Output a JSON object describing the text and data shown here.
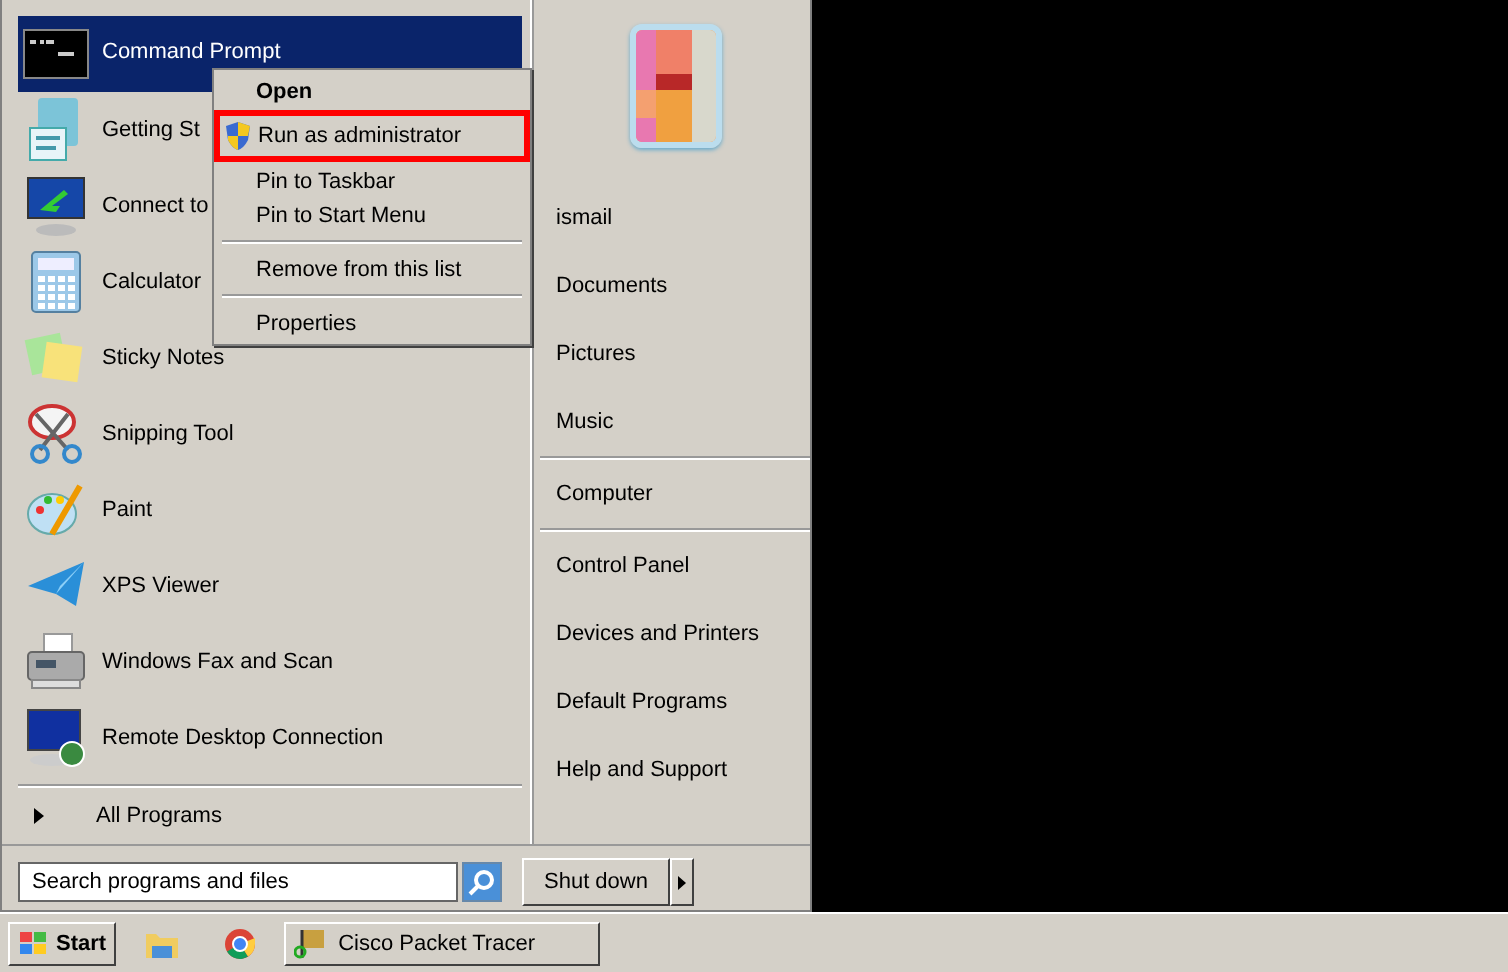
{
  "programs": [
    {
      "label": "Command Prompt",
      "selected": true
    },
    {
      "label": "Getting St",
      "selected": false
    },
    {
      "label": "Connect to",
      "selected": false
    },
    {
      "label": "Calculator",
      "selected": false
    },
    {
      "label": "Sticky Notes",
      "selected": false
    },
    {
      "label": "Snipping Tool",
      "selected": false
    },
    {
      "label": "Paint",
      "selected": false
    },
    {
      "label": "XPS Viewer",
      "selected": false
    },
    {
      "label": "Windows Fax and Scan",
      "selected": false
    },
    {
      "label": "Remote Desktop Connection",
      "selected": false
    }
  ],
  "all_programs": "All Programs",
  "search": {
    "placeholder": "Search programs and files"
  },
  "places": [
    {
      "label": "ismail",
      "kind": "item"
    },
    {
      "label": "Documents",
      "kind": "item"
    },
    {
      "label": "Pictures",
      "kind": "item"
    },
    {
      "label": "Music",
      "kind": "item"
    },
    {
      "kind": "separator"
    },
    {
      "label": "Computer",
      "kind": "item"
    },
    {
      "kind": "separator"
    },
    {
      "label": "Control Panel",
      "kind": "item"
    },
    {
      "label": "Devices and Printers",
      "kind": "item"
    },
    {
      "label": "Default Programs",
      "kind": "item"
    },
    {
      "label": "Help and Support",
      "kind": "item"
    }
  ],
  "shutdown": "Shut down",
  "context_menu": [
    {
      "label": "Open",
      "kind": "default",
      "highlighted": false
    },
    {
      "label": "Run as administrator",
      "kind": "shield",
      "highlighted": true
    },
    {
      "label": "Pin to Taskbar",
      "kind": "item",
      "highlighted": false
    },
    {
      "label": "Pin to Start Menu",
      "kind": "item",
      "highlighted": false
    },
    {
      "kind": "separator"
    },
    {
      "label": "Remove from this list",
      "kind": "item",
      "highlighted": false
    },
    {
      "kind": "separator"
    },
    {
      "label": "Properties",
      "kind": "item",
      "highlighted": false
    }
  ],
  "taskbar": {
    "start": "Start",
    "window": "Cisco Packet Tracer"
  }
}
